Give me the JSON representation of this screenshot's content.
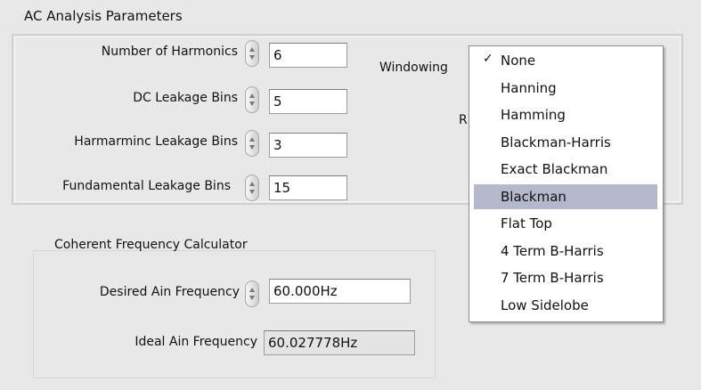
{
  "ac_analysis": {
    "title": "AC Analysis Parameters",
    "number_of_harmonics": {
      "label": "Number of Harmonics",
      "value": "6"
    },
    "dc_leakage_bins": {
      "label": "DC Leakage Bins",
      "value": "5"
    },
    "harmonic_leakage_bins": {
      "label": "Harmarminc Leakage Bins",
      "value": "3"
    },
    "fundamental_leakage_bins": {
      "label": "Fundamental Leakage Bins",
      "value": "15"
    },
    "windowing_label": "Windowing",
    "partial_label": "R"
  },
  "coherent": {
    "title": "Coherent Frequency Calculator",
    "desired": {
      "label": "Desired Ain Frequency",
      "value": "60.000Hz"
    },
    "ideal": {
      "label": "Ideal Ain Frequency",
      "value": "60.027778Hz"
    }
  },
  "windowing_menu": {
    "checked_index": 0,
    "highlighted_index": 5,
    "checkmark": "✓",
    "items": [
      "None",
      "Hanning",
      "Hamming",
      "Blackman-Harris",
      "Exact Blackman",
      "Blackman",
      "Flat Top",
      "4 Term B-Harris",
      "7 Term B-Harris",
      "Low Sidelobe"
    ]
  },
  "colors": {
    "background": "#e8e8e8",
    "menu_highlight": "#b5b7cb",
    "readonly_field": "#e4e4e4"
  }
}
